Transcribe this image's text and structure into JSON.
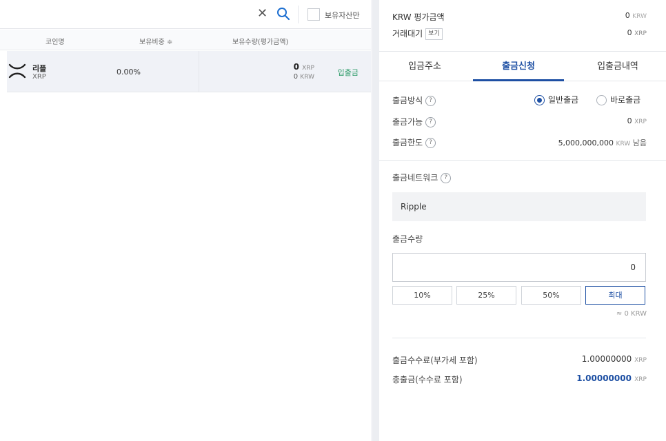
{
  "search": {
    "placeholder": "",
    "value": "",
    "clear_glyph": "✕",
    "holdings_only_label": "보유자산만"
  },
  "table": {
    "headers": {
      "coin": "코인명",
      "ratio": "보유비중 ≑",
      "quantity": "보유수량(평가금액)"
    },
    "rows": [
      {
        "name": "리플",
        "symbol": "XRP",
        "ratio": "0.00%",
        "quantity": "0",
        "quantity_unit": "XRP",
        "value": "0",
        "value_unit": "KRW",
        "action": "입출금"
      }
    ]
  },
  "summary": {
    "krw_value_label": "KRW 평가금액",
    "krw_value": "0",
    "krw_value_unit": "KRW",
    "pending_label": "거래대기",
    "view_label": "보기",
    "pending_value": "0",
    "pending_unit": "XRP"
  },
  "tabs": [
    {
      "label": "입금주소",
      "active": false
    },
    {
      "label": "출금신청",
      "active": true
    },
    {
      "label": "입출금내역",
      "active": false
    }
  ],
  "withdraw": {
    "method_label": "출금방식",
    "help_glyph": "?",
    "method_options": [
      {
        "label": "일반출금",
        "selected": true
      },
      {
        "label": "바로출금",
        "selected": false
      }
    ],
    "available_label": "출금가능",
    "available_value": "0",
    "available_unit": "XRP",
    "limit_label": "출금한도",
    "limit_value": "5,000,000,000",
    "limit_unit": "KRW",
    "limit_suffix": "남음",
    "network_label": "출금네트워크",
    "network_value": "Ripple",
    "amount_label": "출금수량",
    "amount_value": "0",
    "percent_buttons": [
      "10%",
      "25%",
      "50%",
      "최대"
    ],
    "approx_krw": "≈ 0 KRW",
    "fee_label": "출금수수료(부가세 포함)",
    "fee_value": "1.00000000",
    "fee_unit": "XRP",
    "total_label": "총출금(수수료 포함)",
    "total_value": "1.00000000",
    "total_unit": "XRP"
  },
  "colors": {
    "accent": "#1d4fa3",
    "link_green": "#2c9b68"
  }
}
